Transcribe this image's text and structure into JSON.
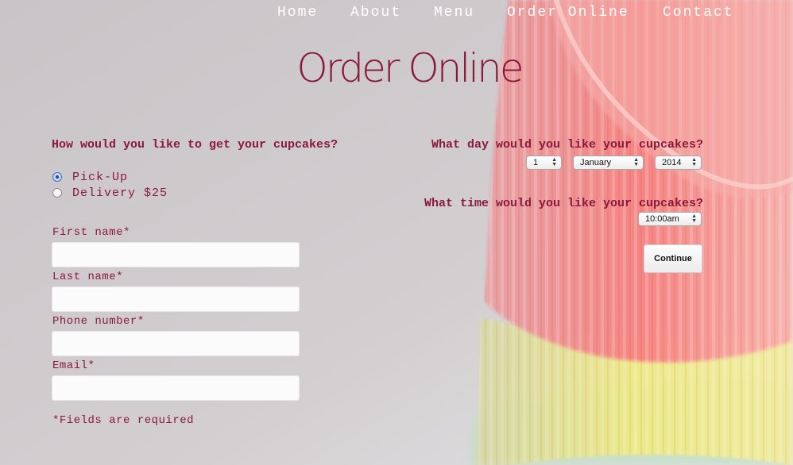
{
  "nav": {
    "items": [
      "Home",
      "About",
      "Menu",
      "Order Online",
      "Contact"
    ]
  },
  "page": {
    "title": "Order Online"
  },
  "pickup_question": "How would you like to get your cupcakes?",
  "delivery_options": [
    {
      "label": "Pick-Up",
      "checked": true
    },
    {
      "label": "Delivery $25",
      "checked": false
    }
  ],
  "fields": {
    "first_name_label": "First name*",
    "last_name_label": "Last name*",
    "phone_label": "Phone number*",
    "email_label": "Email*"
  },
  "required_note": "*Fields are required",
  "day_question": "What day would you like your cupcakes?",
  "date": {
    "day": "1",
    "month": "January",
    "year": "2014"
  },
  "time_question": "What time would you like your cupcakes?",
  "time": {
    "value": "10:00am"
  },
  "continue_label": "Continue",
  "colors": {
    "accent": "#8a1a3c",
    "nav_text": "#ffffff",
    "background": "#cfcbcd"
  }
}
